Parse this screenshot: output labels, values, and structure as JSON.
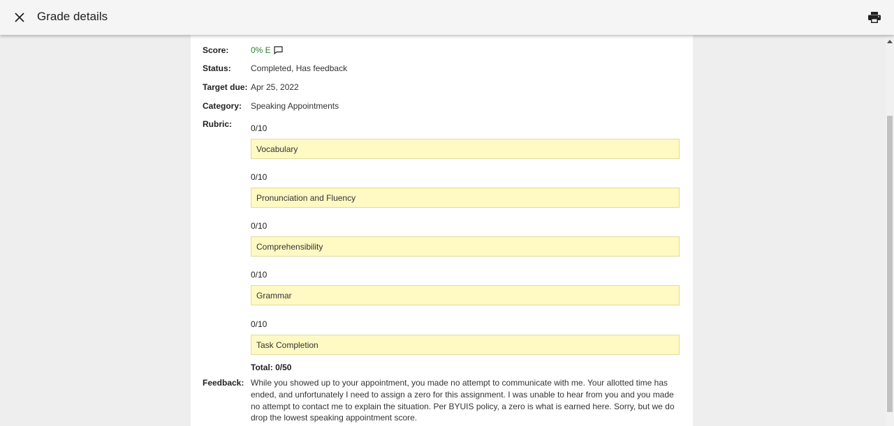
{
  "header": {
    "title": "Grade details",
    "close_icon": "close-icon",
    "print_icon": "print-icon"
  },
  "details": {
    "score_label": "Score:",
    "score_value": "0% E",
    "status_label": "Status:",
    "status_value": "Completed, Has feedback",
    "due_label": "Target due:",
    "due_value": "Apr 25, 2022",
    "category_label": "Category:",
    "category_value": "Speaking Appointments",
    "rubric_label": "Rubric:"
  },
  "rubric": [
    {
      "score": "0/10",
      "criterion": "Vocabulary"
    },
    {
      "score": "0/10",
      "criterion": "Pronunciation and Fluency"
    },
    {
      "score": "0/10",
      "criterion": "Comprehensibility"
    },
    {
      "score": "0/10",
      "criterion": "Grammar"
    },
    {
      "score": "0/10",
      "criterion": "Task Completion"
    }
  ],
  "total": "Total: 0/50",
  "feedback": {
    "label": "Feedback:",
    "text": "While you showed up to your appointment, you made no attempt to communicate with me.  Your allotted time has ended, and unfortunately I need to assign a zero for this assignment.  I was unable to hear from you and you made no attempt to contact me to explain the situation.  Per BYUIS policy, a zero is what is earned here.  Sorry, but we do drop the lowest speaking appointment score."
  },
  "colors": {
    "score": "#2e7d32",
    "rubric_highlight": "#fff9c4",
    "header_bg": "#f5f5f5",
    "page_bg": "#eeeeee"
  }
}
